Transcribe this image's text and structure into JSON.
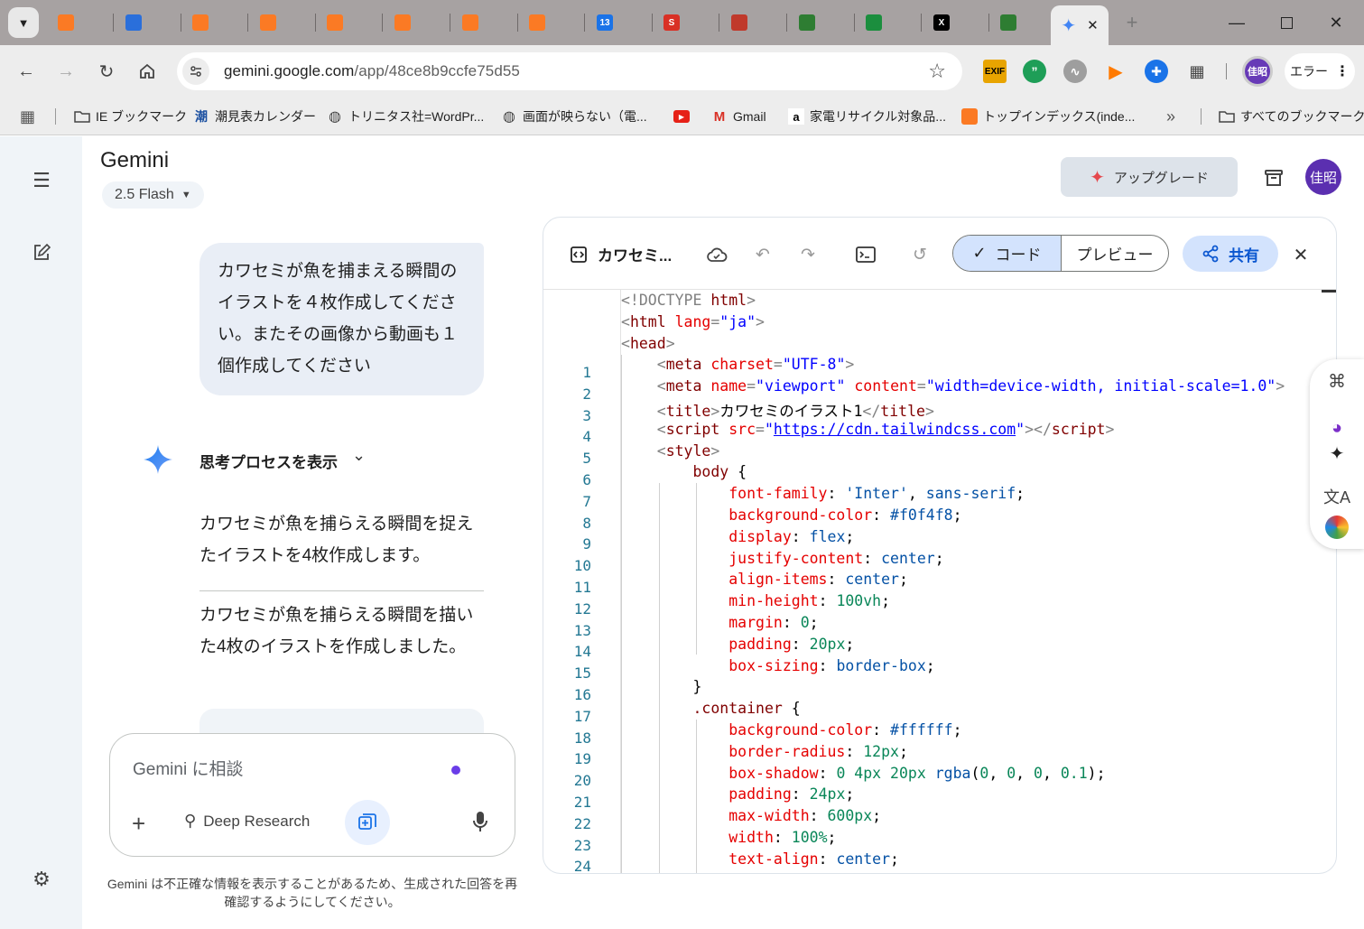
{
  "browser": {
    "tabs": [
      {
        "icon": "xampp-icon",
        "color": "#fb7a24"
      },
      {
        "icon": "cube-icon",
        "color": "#2a6fdb"
      },
      {
        "icon": "xampp-icon",
        "color": "#fb7a24"
      },
      {
        "icon": "xampp-icon",
        "color": "#fb7a24"
      },
      {
        "icon": "xampp-icon",
        "color": "#fb7a24"
      },
      {
        "icon": "xampp-icon",
        "color": "#fb7a24"
      },
      {
        "icon": "xampp-icon",
        "color": "#fb7a24"
      },
      {
        "icon": "xampp-icon",
        "color": "#fb7a24"
      },
      {
        "icon": "calendar-icon",
        "color": "#1a73e8",
        "label": "13"
      },
      {
        "icon": "s-icon",
        "color": "#d93025",
        "label": "S"
      },
      {
        "icon": "chart-icon",
        "color": "#c0392b"
      },
      {
        "icon": "site-icon",
        "color": "#2e7d32"
      },
      {
        "icon": "globe-icon",
        "color": "#1b8e3e"
      },
      {
        "icon": "x-icon",
        "color": "#000000",
        "label": "X"
      },
      {
        "icon": "site-icon",
        "color": "#2e7d32"
      }
    ],
    "active_tab": {
      "icon": "gemini-sparkle-icon",
      "close": "✕"
    },
    "url_host": "gemini.google.com",
    "url_path": "/app/48ce8b9ccfe75d55",
    "error_label": "エラー",
    "profile_label": "佳昭",
    "bookmarks": [
      {
        "icon": "folder-icon",
        "label": "IE ブックマーク"
      },
      {
        "icon": "tide-icon",
        "label": "潮見表カレンダー",
        "glyph": "潮"
      },
      {
        "icon": "globe-icon",
        "label": "トリニタス社=WordPr..."
      },
      {
        "icon": "globe-icon",
        "label": "画面が映らない（電..."
      },
      {
        "icon": "youtube-icon",
        "label": ""
      },
      {
        "icon": "gmail-icon",
        "label": "Gmail"
      },
      {
        "icon": "amazon-icon",
        "label": "家電リサイクル対象品..."
      },
      {
        "icon": "xampp-icon",
        "label": "トップインデックス(inde..."
      }
    ],
    "all_bookmarks": "すべてのブックマーク",
    "more_chevron": "»"
  },
  "gemini": {
    "app_name": "Gemini",
    "model": "2.5 Flash",
    "upgrade_label": "アップグレード",
    "avatar_label": "佳昭",
    "user_message": "カワセミが魚を捕まえる瞬間のイラストを４枚作成してください。またその画像から動画も１個作成してください",
    "thinking_label": "思考プロセスを表示",
    "response_1": "カワセミが魚を捕らえる瞬間を捉えたイラストを4枚作成します。",
    "response_2": "カワセミが魚を捕らえる瞬間を描いた4枚のイラストを作成しました。",
    "input_placeholder": "Gemini に相談",
    "deep_research_label": "Deep Research",
    "disclaimer": "Gemini は不正確な情報を表示することがあるため、生成された回答を再確認するようにしてください。"
  },
  "canvas": {
    "doc_title": "カワセミ...",
    "code_tab": "コード",
    "preview_tab": "プレビュー",
    "share_label": "共有",
    "colors": {
      "tag": "#800000",
      "attr": "#e50000",
      "string": "#0000ff",
      "number": "#098658",
      "value": "#0451a5"
    },
    "lines": [
      [
        [
          "g",
          "<!DOCTYPE "
        ],
        [
          "t",
          "html"
        ],
        [
          "g",
          ">"
        ]
      ],
      [
        [
          "g",
          "<"
        ],
        [
          "t",
          "html "
        ],
        [
          "a",
          "lang"
        ],
        [
          "g",
          "="
        ],
        [
          "s",
          "\"ja\""
        ],
        [
          "g",
          ">"
        ]
      ],
      [
        [
          "g",
          "<"
        ],
        [
          "t",
          "head"
        ],
        [
          "g",
          ">"
        ]
      ],
      [
        [
          "x",
          "    "
        ],
        [
          "g",
          "<"
        ],
        [
          "t",
          "meta "
        ],
        [
          "a",
          "charset"
        ],
        [
          "g",
          "="
        ],
        [
          "s",
          "\"UTF-8\""
        ],
        [
          "g",
          ">"
        ]
      ],
      [
        [
          "x",
          "    "
        ],
        [
          "g",
          "<"
        ],
        [
          "t",
          "meta "
        ],
        [
          "a",
          "name"
        ],
        [
          "g",
          "="
        ],
        [
          "s",
          "\"viewport\" "
        ],
        [
          "a",
          "content"
        ],
        [
          "g",
          "="
        ],
        [
          "s",
          "\"width=device-width, initial-scale=1.0\""
        ],
        [
          "g",
          ">"
        ]
      ],
      [
        [
          "x",
          "    "
        ],
        [
          "g",
          "<"
        ],
        [
          "t",
          "title"
        ],
        [
          "g",
          ">"
        ],
        [
          "x",
          "カワセミのイラスト1"
        ],
        [
          "g",
          "</"
        ],
        [
          "t",
          "title"
        ],
        [
          "g",
          ">"
        ]
      ],
      [
        [
          "x",
          "    "
        ],
        [
          "g",
          "<"
        ],
        [
          "t",
          "script "
        ],
        [
          "a",
          "src"
        ],
        [
          "g",
          "="
        ],
        [
          "s",
          "\""
        ],
        [
          "u",
          "https://cdn.tailwindcss.com"
        ],
        [
          "s",
          "\""
        ],
        [
          "g",
          "></"
        ],
        [
          "t",
          "script"
        ],
        [
          "g",
          ">"
        ]
      ],
      [
        [
          "x",
          "    "
        ],
        [
          "g",
          "<"
        ],
        [
          "t",
          "style"
        ],
        [
          "g",
          ">"
        ]
      ],
      [
        [
          "x",
          "        "
        ],
        [
          "t",
          "body "
        ],
        [
          "x",
          "{"
        ]
      ],
      [
        [
          "x",
          "            "
        ],
        [
          "a",
          "font-family"
        ],
        [
          "x",
          ": "
        ],
        [
          "v",
          "'Inter'"
        ],
        [
          "x",
          ", "
        ],
        [
          "v",
          "sans-serif"
        ],
        [
          "x",
          ";"
        ]
      ],
      [
        [
          "x",
          "            "
        ],
        [
          "a",
          "background-color"
        ],
        [
          "x",
          ": "
        ],
        [
          "v",
          "#f0f4f8"
        ],
        [
          "x",
          ";"
        ]
      ],
      [
        [
          "x",
          "            "
        ],
        [
          "a",
          "display"
        ],
        [
          "x",
          ": "
        ],
        [
          "v",
          "flex"
        ],
        [
          "x",
          ";"
        ]
      ],
      [
        [
          "x",
          "            "
        ],
        [
          "a",
          "justify-content"
        ],
        [
          "x",
          ": "
        ],
        [
          "v",
          "center"
        ],
        [
          "x",
          ";"
        ]
      ],
      [
        [
          "x",
          "            "
        ],
        [
          "a",
          "align-items"
        ],
        [
          "x",
          ": "
        ],
        [
          "v",
          "center"
        ],
        [
          "x",
          ";"
        ]
      ],
      [
        [
          "x",
          "            "
        ],
        [
          "a",
          "min-height"
        ],
        [
          "x",
          ": "
        ],
        [
          "n",
          "100vh"
        ],
        [
          "x",
          ";"
        ]
      ],
      [
        [
          "x",
          "            "
        ],
        [
          "a",
          "margin"
        ],
        [
          "x",
          ": "
        ],
        [
          "n",
          "0"
        ],
        [
          "x",
          ";"
        ]
      ],
      [
        [
          "x",
          "            "
        ],
        [
          "a",
          "padding"
        ],
        [
          "x",
          ": "
        ],
        [
          "n",
          "20px"
        ],
        [
          "x",
          ";"
        ]
      ],
      [
        [
          "x",
          "            "
        ],
        [
          "a",
          "box-sizing"
        ],
        [
          "x",
          ": "
        ],
        [
          "v",
          "border-box"
        ],
        [
          "x",
          ";"
        ]
      ],
      [
        [
          "x",
          "        "
        ],
        [
          "x",
          "}"
        ]
      ],
      [
        [
          "x",
          "        "
        ],
        [
          "t",
          ".container "
        ],
        [
          "x",
          "{"
        ]
      ],
      [
        [
          "x",
          "            "
        ],
        [
          "a",
          "background-color"
        ],
        [
          "x",
          ": "
        ],
        [
          "v",
          "#ffffff"
        ],
        [
          "x",
          ";"
        ]
      ],
      [
        [
          "x",
          "            "
        ],
        [
          "a",
          "border-radius"
        ],
        [
          "x",
          ": "
        ],
        [
          "n",
          "12px"
        ],
        [
          "x",
          ";"
        ]
      ],
      [
        [
          "x",
          "            "
        ],
        [
          "a",
          "box-shadow"
        ],
        [
          "x",
          ": "
        ],
        [
          "n",
          "0 4px 20px "
        ],
        [
          "v",
          "rgba"
        ],
        [
          "x",
          "("
        ],
        [
          "n",
          "0"
        ],
        [
          "x",
          ", "
        ],
        [
          "n",
          "0"
        ],
        [
          "x",
          ", "
        ],
        [
          "n",
          "0"
        ],
        [
          "x",
          ", "
        ],
        [
          "n",
          "0.1"
        ],
        [
          "x",
          ");"
        ]
      ],
      [
        [
          "x",
          "            "
        ],
        [
          "a",
          "padding"
        ],
        [
          "x",
          ": "
        ],
        [
          "n",
          "24px"
        ],
        [
          "x",
          ";"
        ]
      ],
      [
        [
          "x",
          "            "
        ],
        [
          "a",
          "max-width"
        ],
        [
          "x",
          ": "
        ],
        [
          "n",
          "600px"
        ],
        [
          "x",
          ";"
        ]
      ],
      [
        [
          "x",
          "            "
        ],
        [
          "a",
          "width"
        ],
        [
          "x",
          ": "
        ],
        [
          "n",
          "100%"
        ],
        [
          "x",
          ";"
        ]
      ],
      [
        [
          "x",
          "            "
        ],
        [
          "a",
          "text-align"
        ],
        [
          "x",
          ": "
        ],
        [
          "v",
          "center"
        ],
        [
          "x",
          ";"
        ]
      ]
    ]
  }
}
